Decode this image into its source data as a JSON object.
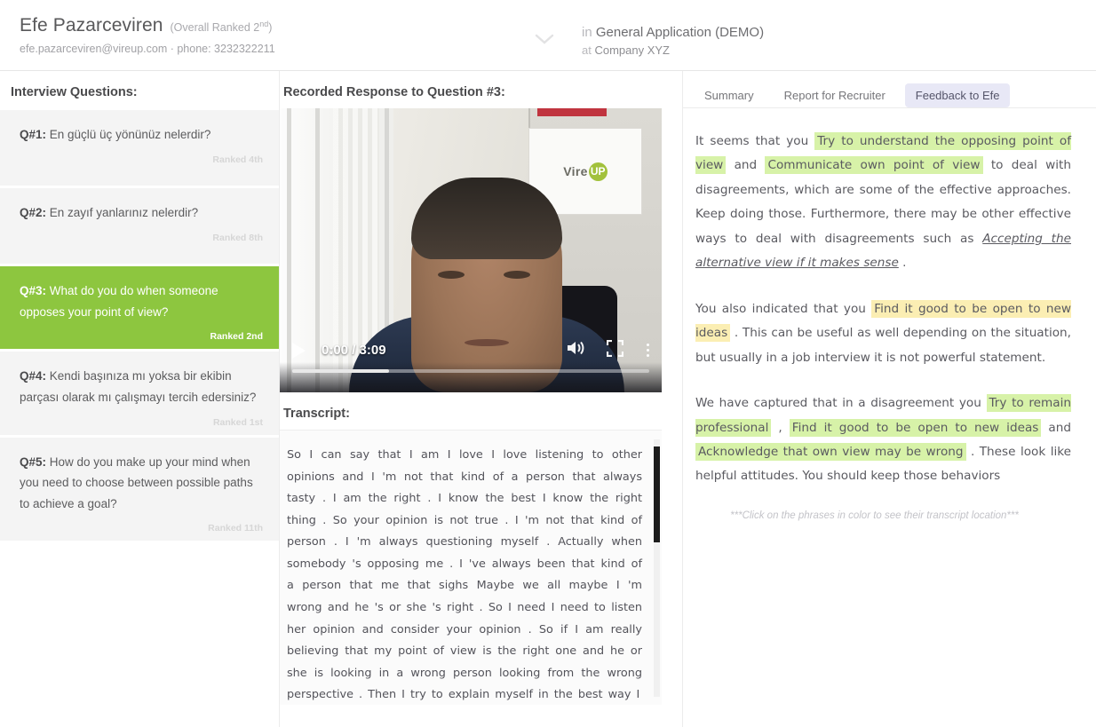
{
  "header": {
    "candidate_name": "Efe Pazarceviren",
    "overall_rank_prefix": "(Overall Ranked 2",
    "overall_rank_sup": "nd",
    "overall_rank_suffix": ")",
    "contact": "efe.pazarceviren@vireup.com · phone: 3232322211",
    "position_prefix": "in ",
    "position": "General Application (DEMO)",
    "company_prefix": "at ",
    "company": "Company XYZ",
    "chevron_icon": "chevron-down-icon"
  },
  "left_panel": {
    "title": "Interview Questions:",
    "questions": [
      {
        "num": "Q#1:",
        "text": " En güçlü üç yönünüz nelerdir?",
        "rank": "Ranked 4th",
        "active": false
      },
      {
        "num": "Q#2:",
        "text": " En zayıf yanlarınız nelerdir?",
        "rank": "Ranked 8th",
        "active": false
      },
      {
        "num": "Q#3:",
        "text": " What do you do when someone opposes your point of view?",
        "rank": "Ranked 2nd",
        "active": true
      },
      {
        "num": "Q#4:",
        "text": " Kendi başınıza mı yoksa bir ekibin parçası olarak mı çalışmayı tercih edersiniz?",
        "rank": "Ranked 1st",
        "active": false
      },
      {
        "num": "Q#5:",
        "text": " How do you make up your mind when you need to choose between possible paths to achieve a goal?",
        "rank": "Ranked 11th",
        "active": false
      }
    ]
  },
  "middle_panel": {
    "video_title": "Recorded Response to Question #3:",
    "video": {
      "current_time": "0:00",
      "separator": " / ",
      "duration": "3:09",
      "time_display": "0:00 / 3:09",
      "play_icon": "play-icon",
      "volume_icon": "volume-icon",
      "fullscreen_icon": "fullscreen-icon",
      "more_icon": "more-options-icon",
      "progress_percent": 27,
      "overlay_logo_text": "Vire",
      "overlay_logo_badge": "UP"
    },
    "transcript_title": "Transcript:",
    "transcript_text": "So I can say that I am I love I love listening to other opinions and I 'm not that kind of a person that always tasty . I am the right . I know the best I know the right thing . So your opinion is not true . I 'm not that kind of person . I 'm always questioning myself . Actually when somebody 's opposing me . I 've always been that kind of a person that me that sighs Maybe we all maybe I 'm wrong and he 's or she 's right . So I need I need to listen her opinion and consider your opinion . So if I am really believing that my point of view is the right one and he or she is looking in a wrong person looking from the wrong perspective . Then I try to explain myself in the best way I"
  },
  "right_panel": {
    "tabs": [
      {
        "label": "Summary",
        "active": false
      },
      {
        "label": "Report for Recruiter",
        "active": false
      },
      {
        "label": "Feedback to Efe",
        "active": true
      }
    ],
    "paragraph1": {
      "s1": "It seems that you ",
      "h1": "Try to understand the opposing point of view",
      "s2": " and ",
      "h2": "Communicate own point of view",
      "s3": " to deal with disagreements, which are some of the effective approaches. Keep doing those. Furthermore, there may be other effective ways to deal with disagreements such as ",
      "h3": "Accepting the alternative view if it makes sense",
      "s4": " ."
    },
    "paragraph2": {
      "s1": "You also indicated that you ",
      "h1": "Find it good to be open to new ideas",
      "s2": " . This can be useful as well depending on the situation, but usually in a job interview it is not powerful statement."
    },
    "paragraph3": {
      "s1": "We have captured that in a disagreement you ",
      "h1": "Try to remain professional",
      "s2": " , ",
      "h2": "Find it good to be open to new ideas",
      "s3": " and ",
      "h3": "Acknowledge that own view may be wrong",
      "s4": " . These look like helpful attitudes. You should keep those behaviors"
    },
    "note": "***Click on the phrases in color to see their transcript location***"
  },
  "colors": {
    "accent_green": "#8dc63f",
    "highlight_green": "#d7f2a8",
    "highlight_yellow": "#fbeeb3",
    "active_tab_bg": "#e8e8f6",
    "card_bg": "#f4f4f4"
  }
}
